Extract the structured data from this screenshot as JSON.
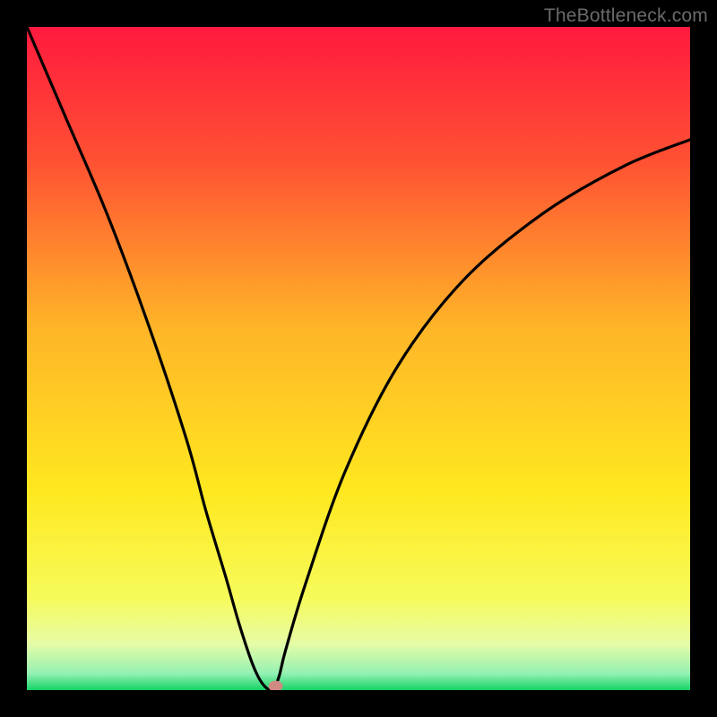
{
  "watermark": "TheBottleneck.com",
  "chart_data": {
    "type": "line",
    "title": "",
    "xlabel": "",
    "ylabel": "",
    "xlim": [
      0,
      100
    ],
    "ylim": [
      0,
      100
    ],
    "grid": false,
    "legend": false,
    "series": [
      {
        "name": "curve",
        "x": [
          0,
          6,
          12,
          18,
          24,
          27,
          30,
          32,
          34,
          35.5,
          37,
          38,
          39,
          42,
          48,
          56,
          66,
          78,
          90,
          100
        ],
        "values": [
          100,
          86,
          72,
          56,
          38,
          27,
          17,
          10,
          4,
          1,
          0,
          2,
          6,
          16,
          33,
          49,
          62,
          72,
          79,
          83
        ]
      }
    ],
    "marker": {
      "x": 37.5,
      "y": 0.6,
      "color": "#d08a82"
    },
    "background_gradient": {
      "stops": [
        {
          "pos": 0.0,
          "color": "#ff1a3e"
        },
        {
          "pos": 0.2,
          "color": "#ff5033"
        },
        {
          "pos": 0.45,
          "color": "#ffb428"
        },
        {
          "pos": 0.7,
          "color": "#ffe81f"
        },
        {
          "pos": 0.86,
          "color": "#f6fb5a"
        },
        {
          "pos": 0.93,
          "color": "#e6fca6"
        },
        {
          "pos": 0.975,
          "color": "#94f1b4"
        },
        {
          "pos": 1.0,
          "color": "#15d267"
        }
      ]
    }
  }
}
